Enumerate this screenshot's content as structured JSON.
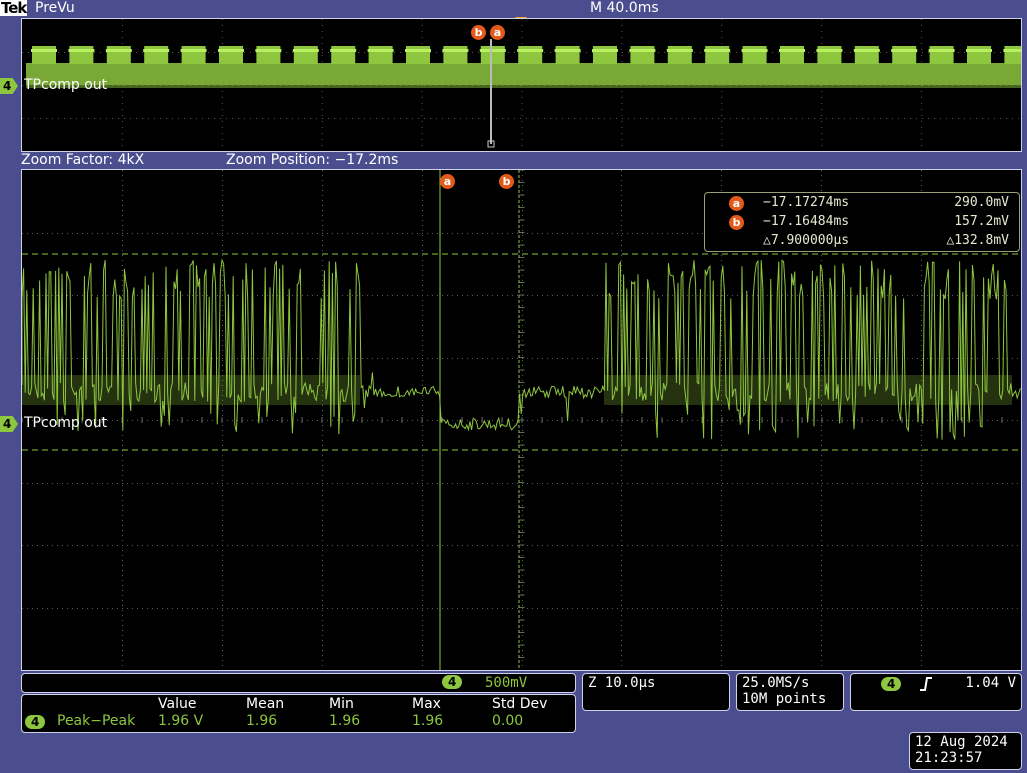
{
  "header": {
    "brand": "Tek",
    "mode": "PreVu",
    "timebase": "M 40.0ms"
  },
  "overview": {
    "channel_num": "4",
    "channel_label": "TPcomp out",
    "cursor_a": "a",
    "cursor_b": "b"
  },
  "zoom": {
    "factor": "Zoom Factor: 4kX",
    "position": "Zoom Position: −17.2ms"
  },
  "main": {
    "channel_num": "4",
    "channel_label": "TPcomp out",
    "cursor_a": "a",
    "cursor_b": "b"
  },
  "cursor_readout": {
    "a_label": "a",
    "a_time": "−17.17274ms",
    "a_volt": "290.0mV",
    "b_label": "b",
    "b_time": "−17.16484ms",
    "b_volt": "157.2mV",
    "delta_time": "△7.900000µs",
    "delta_volt": "△132.8mV"
  },
  "scale_bar": {
    "channel": "4",
    "volts_div": "500mV"
  },
  "measurement": {
    "headers": [
      "Value",
      "Mean",
      "Min",
      "Max",
      "Std Dev"
    ],
    "channel": "4",
    "name": "Peak−Peak",
    "values": [
      "1.96 V",
      "1.96",
      "1.96",
      "1.96",
      "0.00"
    ]
  },
  "zoom_time": "Z 10.0µs",
  "acquisition": {
    "rate": "25.0MS/s",
    "points": "10M points"
  },
  "trigger": {
    "channel": "4",
    "slope_icon": "rising-edge-icon",
    "level": "1.04 V"
  },
  "datetime": {
    "date": "12 Aug 2024",
    "time": "21:23:57"
  },
  "colors": {
    "trace": "#8ec63f",
    "cursor": "#e25a1c",
    "background": "#000000",
    "frame": "#4a4e8e"
  }
}
